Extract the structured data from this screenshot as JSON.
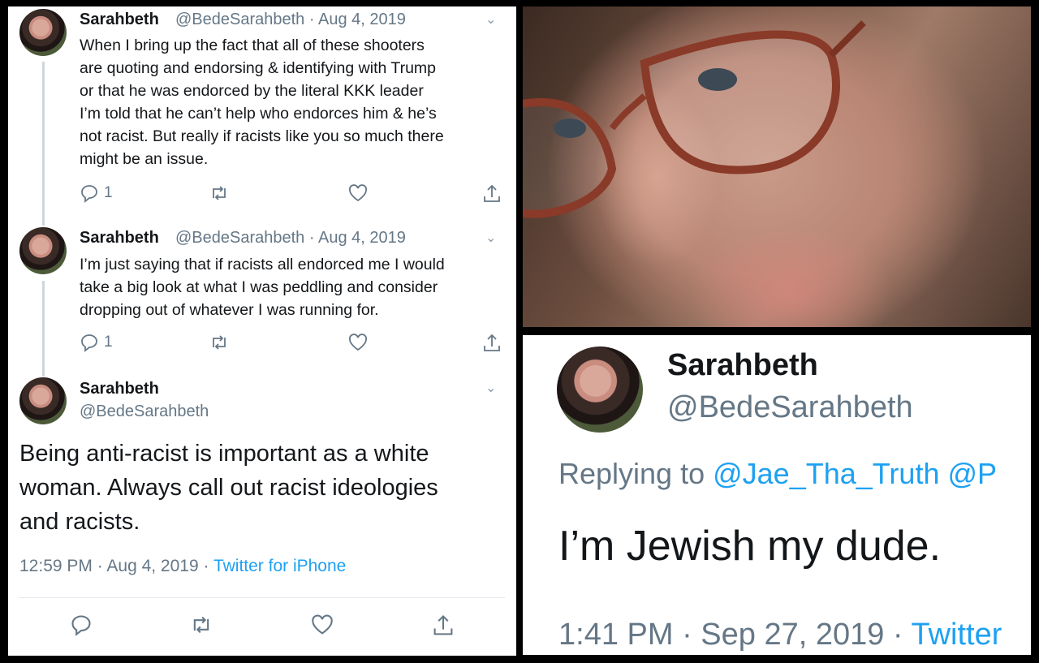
{
  "left": {
    "tweet1": {
      "name": "Sarahbeth",
      "handle_date": "@BedeSarahbeth · Aug 4, 2019",
      "lines": [
        "When I bring up the fact that all of these shooters",
        "are quoting and endorsing & identifying with Trump",
        "or that he was endorced by the literal KKK leader",
        "I’m told that he can’t help who endorces him & he’s",
        "not racist. But really if racists like you so much there",
        "might be an issue."
      ],
      "reply_count": "1"
    },
    "tweet2": {
      "name": "Sarahbeth",
      "handle_date": "@BedeSarahbeth · Aug 4, 2019",
      "lines": [
        "I’m just saying that if racists all endorced me I would",
        "take a big look at what I was peddling and consider",
        "dropping out of whatever I was running for."
      ],
      "reply_count": "1"
    },
    "tweet3": {
      "name": "Sarahbeth",
      "handle": "@BedeSarahbeth",
      "lines": [
        "Being anti-racist is important as a white",
        "woman. Always call out racist ideologies",
        "and racists."
      ],
      "time_date": "12:59 PM · Aug 4, 2019 · ",
      "source": "Twitter for iPhone"
    }
  },
  "right": {
    "name": "Sarahbeth",
    "handle": "@BedeSarahbeth",
    "replying_prefix": "Replying to ",
    "replying_to": "@Jae_Tha_Truth @P",
    "text": "I’m Jewish my dude.",
    "time_date": "1:41 PM · Sep 27, 2019 · ",
    "source": "Twitter"
  },
  "icons": {
    "reply": "reply-icon",
    "retweet": "retweet-icon",
    "like": "like-icon",
    "share": "share-icon",
    "more": "chevron-down-icon"
  },
  "colors": {
    "text": "#14171a",
    "secondary": "#657786",
    "link": "#1da1f2",
    "divider": "#e1e8ed",
    "background": "#000000"
  }
}
